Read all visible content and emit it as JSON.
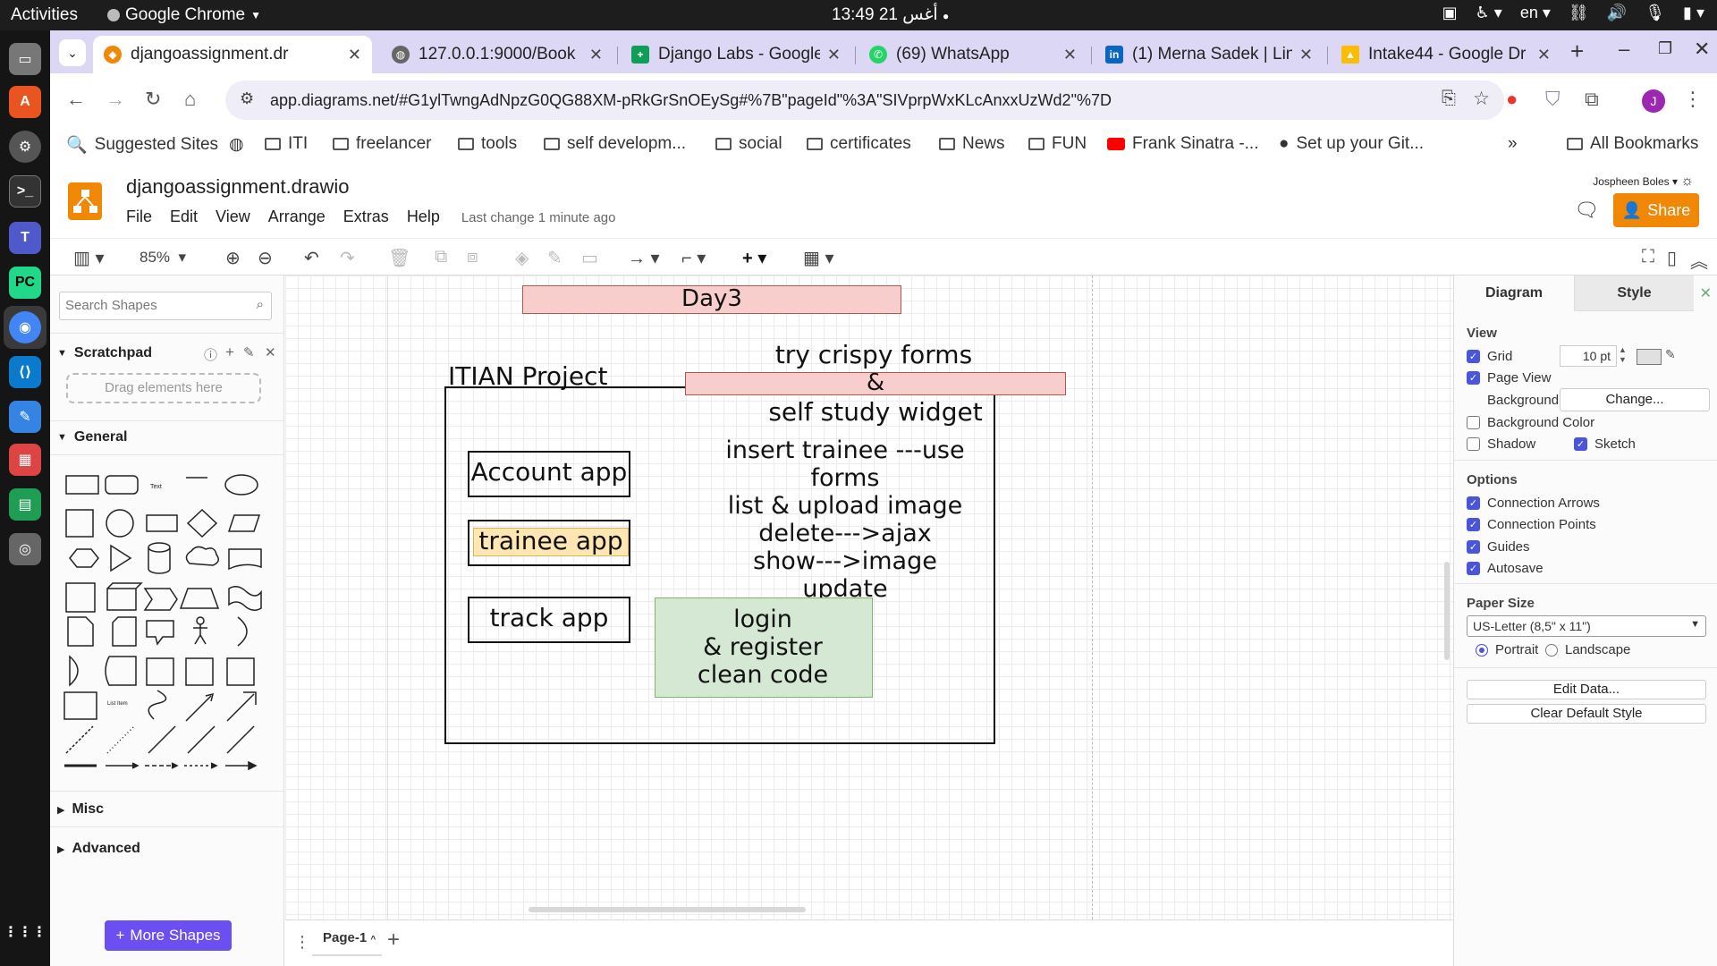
{
  "os": {
    "activities": "Activities",
    "app_name": "Google Chrome",
    "clock": "13:49  21 أغس",
    "lang": "en"
  },
  "browser": {
    "tabs": [
      {
        "title": "djangoassignment.dr",
        "active": true
      },
      {
        "title": "127.0.0.1:9000/Book"
      },
      {
        "title": "Django Labs - Google"
      },
      {
        "title": "(69) WhatsApp"
      },
      {
        "title": "(1) Merna Sadek | Lin"
      },
      {
        "title": "Intake44 - Google Dr"
      }
    ],
    "url": "app.diagrams.net/#G1ylTwngAdNpzG0QG88XM-pRkGrSnOEySg#%7B\"pageId\"%3A\"SIVprpWxKLcAnxxUzWd2\"%7D",
    "profile_initial": "J",
    "bookmarks": [
      "Suggested Sites",
      "ITI",
      "freelancer",
      "tools",
      "self developm...",
      "social",
      "certificates",
      "News",
      "FUN",
      "Frank Sinatra -...",
      "Set up your Git...",
      "All Bookmarks"
    ]
  },
  "drawio": {
    "doc_title": "djangoassignment.drawio",
    "menu": [
      "File",
      "Edit",
      "View",
      "Arrange",
      "Extras",
      "Help"
    ],
    "last_change": "Last change 1 minute ago",
    "user": "Jospheen Boles",
    "share_label": "Share",
    "zoom": "85%",
    "search_placeholder": "Search Shapes",
    "scratchpad_label": "Scratchpad",
    "drag_here": "Drag elements here",
    "general_label": "General",
    "misc_label": "Misc",
    "advanced_label": "Advanced",
    "more_shapes": "More Shapes",
    "page_tab": "Page-1",
    "diagram": {
      "day": "Day3",
      "project_title": "ITIAN Project",
      "try_line1": "try crispy forms",
      "try_line2": "&",
      "try_line3": "self study widget",
      "account_app": "Account app",
      "trainee_app": "trainee app",
      "track_app": "track app",
      "tasks": [
        "insert trainee ---use forms",
        "list & upload image",
        "delete--->ajax",
        "show--->image",
        "update"
      ],
      "login_box": [
        "login",
        "& register",
        "clean code"
      ]
    },
    "right_panel": {
      "tab_diagram": "Diagram",
      "tab_style": "Style",
      "view_heading": "View",
      "grid_label": "Grid",
      "grid_size": "10 pt",
      "page_view_label": "Page View",
      "background_label": "Background",
      "change_btn": "Change...",
      "bg_color_label": "Background Color",
      "shadow_label": "Shadow",
      "sketch_label": "Sketch",
      "options_heading": "Options",
      "connection_arrows": "Connection Arrows",
      "connection_points": "Connection Points",
      "guides": "Guides",
      "autosave": "Autosave",
      "paper_size_heading": "Paper Size",
      "paper_size": "US-Letter (8,5\" x 11\")",
      "portrait": "Portrait",
      "landscape": "Landscape",
      "edit_data": "Edit Data...",
      "clear_style": "Clear Default Style"
    }
  }
}
